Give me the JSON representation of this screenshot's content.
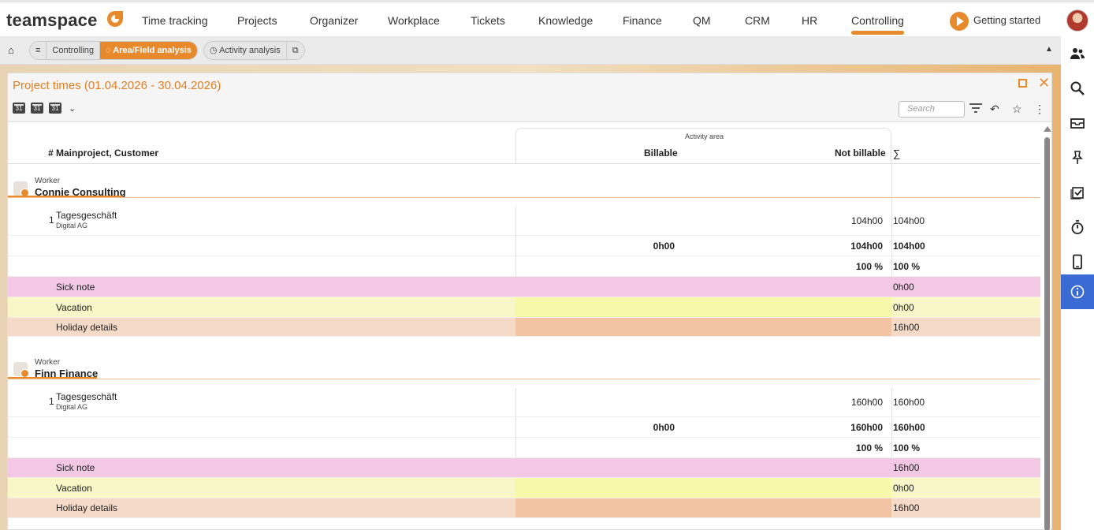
{
  "app": {
    "logo_text": "teamspace"
  },
  "nav": [
    {
      "label": "Time tracking"
    },
    {
      "label": "Projects"
    },
    {
      "label": "Organizer"
    },
    {
      "label": "Workplace"
    },
    {
      "label": "Tickets"
    },
    {
      "label": "Knowledge"
    },
    {
      "label": "Finance"
    },
    {
      "label": "QM"
    },
    {
      "label": "CRM"
    },
    {
      "label": "HR"
    },
    {
      "label": "Controlling",
      "active": true
    }
  ],
  "getting_started": "Getting started",
  "breadcrumb": {
    "menu_icon": "≡",
    "items": [
      "Controlling",
      "Area/Field analysis"
    ],
    "second_group": [
      "Activity analysis"
    ]
  },
  "panel": {
    "title": "Project times (01.04.2026 - 30.04.2026)",
    "search_placeholder": "Search",
    "calendar_label": "31"
  },
  "table": {
    "col_main": "# Mainproject, Customer",
    "group_header": "Activity area",
    "col_billable": "Billable",
    "col_not_billable": "Not billable",
    "col_sum": "∑"
  },
  "workers": [
    {
      "label": "Worker",
      "name": "Connie Consulting",
      "project": {
        "index": "1",
        "name": "Tagesgeschäft",
        "customer": "Digital AG",
        "billable": "",
        "not_billable": "104h00",
        "sum": "104h00"
      },
      "totals": {
        "billable": "0h00",
        "not_billable": "104h00",
        "sum": "104h00"
      },
      "percent": {
        "not_billable": "100 %",
        "sum": "100 %"
      },
      "sick_note": {
        "label": "Sick note",
        "sum": "0h00"
      },
      "vacation": {
        "label": "Vacation",
        "sum": "0h00"
      },
      "holiday": {
        "label": "Holiday details",
        "sum": "16h00"
      }
    },
    {
      "label": "Worker",
      "name": "Finn Finance",
      "project": {
        "index": "1",
        "name": "Tagesgeschäft",
        "customer": "Digital AG",
        "billable": "",
        "not_billable": "160h00",
        "sum": "160h00"
      },
      "totals": {
        "billable": "0h00",
        "not_billable": "160h00",
        "sum": "160h00"
      },
      "percent": {
        "not_billable": "100 %",
        "sum": "100 %"
      },
      "sick_note": {
        "label": "Sick note",
        "sum": "16h00"
      },
      "vacation": {
        "label": "Vacation",
        "sum": "0h00"
      },
      "holiday": {
        "label": "Holiday details",
        "sum": "16h00"
      }
    }
  ],
  "colors": {
    "accent": "#e8892b",
    "sick_note": "#f3c8e4",
    "vacation": "#f7f7c8",
    "holiday": "#f5dac8",
    "rail_active": "#3a6ad4"
  },
  "rail_icons": [
    "users-icon",
    "search-icon",
    "inbox-icon",
    "pin-icon",
    "tasks-icon",
    "stopwatch-icon",
    "mobile-icon",
    "info-icon"
  ]
}
